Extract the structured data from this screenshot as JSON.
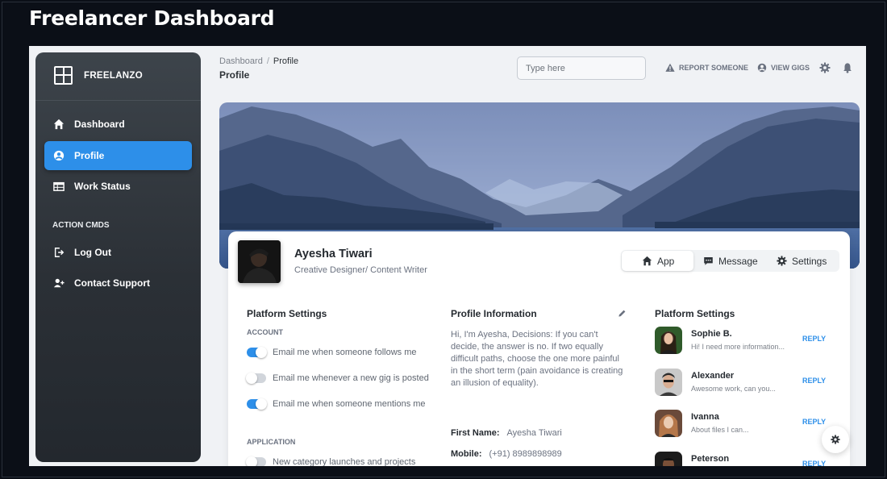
{
  "page_heading": "Freelancer Dashboard",
  "brand": {
    "name": "FREELANZO"
  },
  "sidebar": {
    "items": [
      {
        "label": "Dashboard",
        "icon": "home-icon"
      },
      {
        "label": "Profile",
        "icon": "user-circle-icon",
        "active": true
      },
      {
        "label": "Work Status",
        "icon": "table-icon"
      }
    ],
    "section_label": "ACTION CMDS",
    "actions": [
      {
        "label": "Log Out",
        "icon": "sign-out-icon"
      },
      {
        "label": "Contact Support",
        "icon": "user-plus-icon"
      }
    ]
  },
  "breadcrumb": {
    "root": "Dashboard",
    "separator": "/",
    "current": "Profile"
  },
  "page_title": "Profile",
  "search": {
    "placeholder": "Type here"
  },
  "top_links": {
    "report": "REPORT SOMEONE",
    "view_gigs": "VIEW GIGS"
  },
  "profile": {
    "name": "Ayesha Tiwari",
    "role": "Creative Designer/ Content Writer"
  },
  "tabs": [
    {
      "label": "App",
      "icon": "home-icon",
      "active": true
    },
    {
      "label": "Message",
      "icon": "chat-icon"
    },
    {
      "label": "Settings",
      "icon": "gear-icon"
    }
  ],
  "platform_settings": {
    "title": "Platform Settings",
    "account_label": "ACCOUNT",
    "account_toggles": [
      {
        "label": "Email me when someone follows me",
        "on": true
      },
      {
        "label": "Email me whenever a new gig is posted",
        "on": false
      },
      {
        "label": "Email me when someone mentions me",
        "on": true
      }
    ],
    "application_label": "APPLICATION",
    "application_toggles": [
      {
        "label": "New category launches and projects",
        "on": false
      }
    ]
  },
  "profile_info": {
    "title": "Profile Information",
    "bio": "Hi, I'm Ayesha, Decisions: If you can't decide, the answer is no. If two equally difficult paths, choose the one more painful in the short term (pain avoidance is creating an illusion of equality).",
    "first_name_label": "First Name:",
    "first_name": "Ayesha Tiwari",
    "mobile_label": "Mobile:",
    "mobile": "(+91) 8989898989"
  },
  "conversations": {
    "title": "Platform Settings",
    "reply_label": "REPLY",
    "items": [
      {
        "name": "Sophie B.",
        "message": "Hi! I need more information..."
      },
      {
        "name": "Alexander",
        "message": "Awesome work, can you..."
      },
      {
        "name": "Ivanna",
        "message": "About files I can..."
      },
      {
        "name": "Peterson",
        "message": ""
      }
    ]
  },
  "colors": {
    "accent": "#2d8fe9",
    "sidebar": "#2b3036",
    "background": "#0b0f17"
  }
}
